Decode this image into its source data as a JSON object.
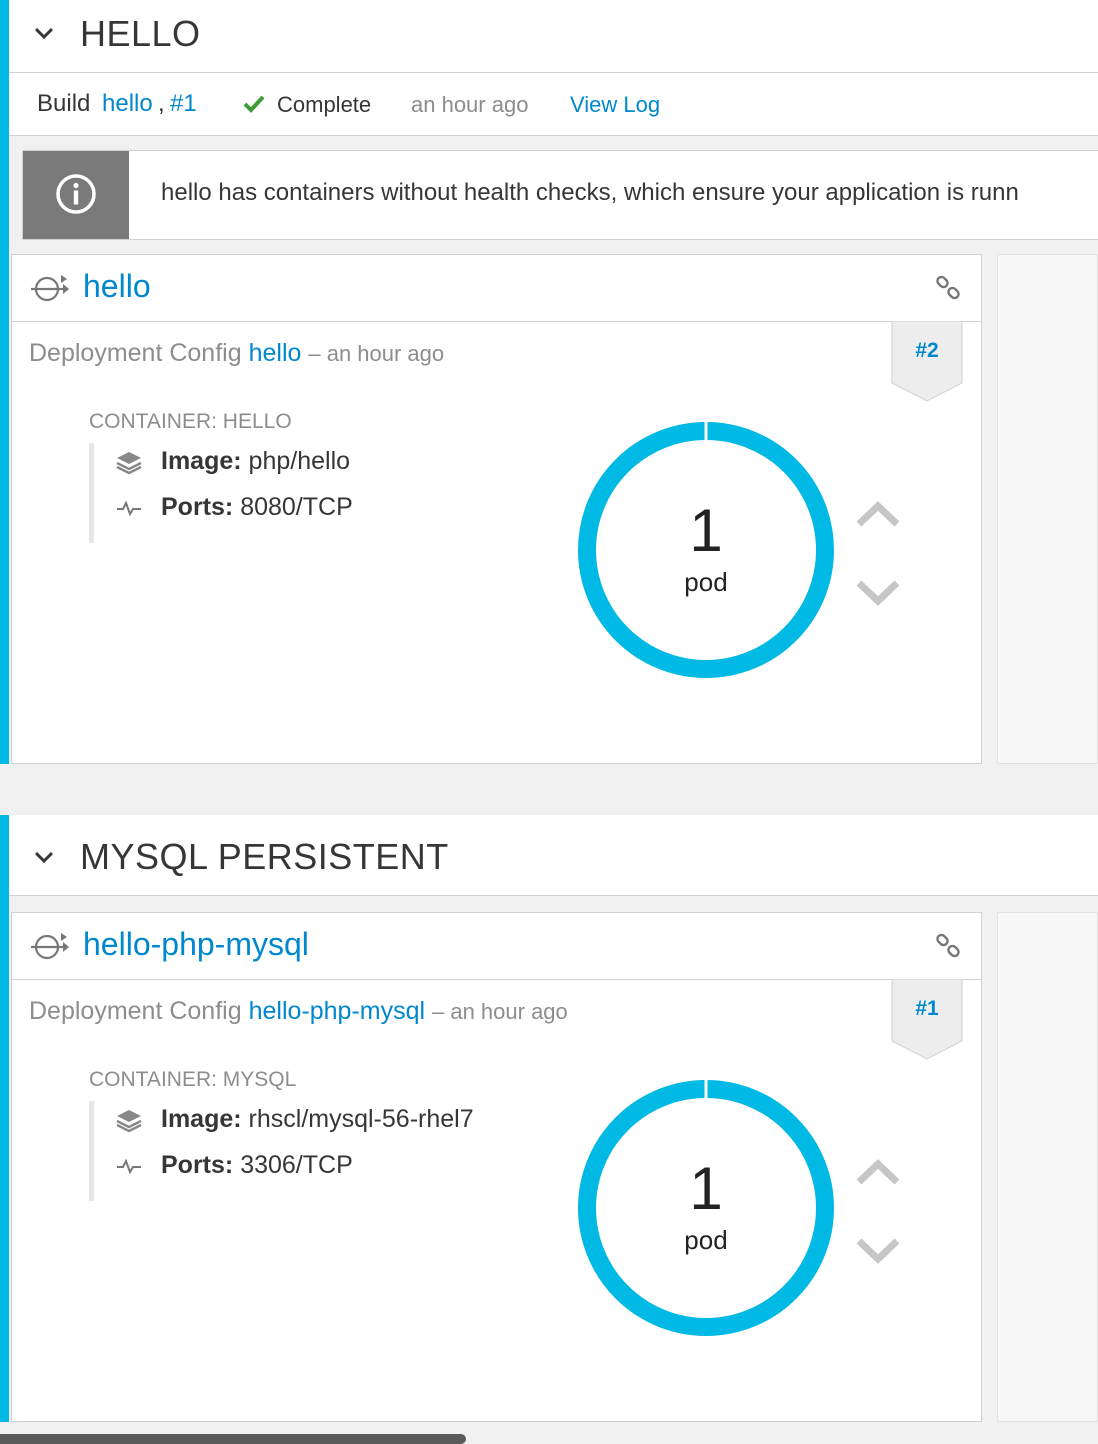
{
  "colors": {
    "accent": "#00b9e4",
    "link": "#0088ce",
    "success": "#3f9c35",
    "donut": "#00b9e4"
  },
  "hello_section": {
    "title": "HELLO",
    "build": {
      "prefix": "Build",
      "name": "hello",
      "separator": ",",
      "number": "#1",
      "status": "Complete",
      "status_icon": "check-icon",
      "time": "an hour ago",
      "view_log": "View Log"
    },
    "alert": {
      "icon": "info-icon",
      "message": "hello has containers without health checks, which ensure your application is runn"
    },
    "card": {
      "name": "hello",
      "dc_label": "Deployment Config",
      "dc_name": "hello",
      "dc_time": "– an hour ago",
      "deployment_badge": "#2",
      "container_label": "CONTAINER: HELLO",
      "image_key": "Image:",
      "image_value": "php/hello",
      "ports_key": "Ports:",
      "ports_value": "8080/TCP",
      "pod_count": "1",
      "pod_unit": "pod"
    }
  },
  "mysql_section": {
    "title": "MYSQL PERSISTENT",
    "card": {
      "name": "hello-php-mysql",
      "dc_label": "Deployment Config",
      "dc_name": "hello-php-mysql",
      "dc_time": "– an hour ago",
      "deployment_badge": "#1",
      "container_label": "CONTAINER: MYSQL",
      "image_key": "Image:",
      "image_value": "rhscl/mysql-56-rhel7",
      "ports_key": "Ports:",
      "ports_value": "3306/TCP",
      "pod_count": "1",
      "pod_unit": "pod"
    }
  }
}
